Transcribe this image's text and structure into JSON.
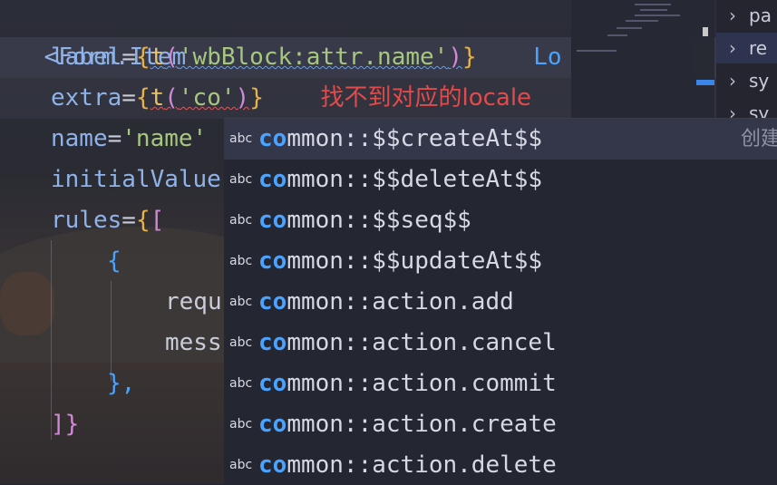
{
  "editor": {
    "lines": {
      "form_item": "<Form.Item",
      "label_attr": "label",
      "label_fn": "t",
      "label_str": "'wbBlock:attr.name'",
      "label_hint": "Lo",
      "extra_attr": "extra",
      "extra_fn": "t",
      "extra_str": "'co'",
      "extra_error": "找不到对应的locale",
      "name_attr": "name",
      "name_str": "'name'",
      "initial_attr": "initialValue",
      "rules_attr": "rules",
      "brace_open": "{",
      "requ": "requ",
      "mess": "mess",
      "brace_close": "},",
      "array_close": "]}"
    }
  },
  "explorer": {
    "items": [
      {
        "label": "pa"
      },
      {
        "label": "re"
      },
      {
        "label": "sy"
      },
      {
        "label": "sy"
      }
    ]
  },
  "suggest": {
    "match_prefix": "co",
    "kind_label": "abc",
    "items": [
      {
        "rest": "mmon::$$createAt$$",
        "detail": "创建"
      },
      {
        "rest": "mmon::$$deleteAt$$",
        "detail": ""
      },
      {
        "rest": "mmon::$$seq$$",
        "detail": ""
      },
      {
        "rest": "mmon::$$updateAt$$",
        "detail": ""
      },
      {
        "rest": "mmon::action.add",
        "detail": ""
      },
      {
        "rest": "mmon::action.cancel",
        "detail": ""
      },
      {
        "rest": "mmon::action.commit",
        "detail": ""
      },
      {
        "rest": "mmon::action.create",
        "detail": ""
      },
      {
        "rest": "mmon::action.delete",
        "detail": ""
      }
    ]
  },
  "colors": {
    "accent": "#4aa3ff",
    "error": "#e24b4b",
    "string": "#a7c77f",
    "brace": "#e6b34a"
  }
}
